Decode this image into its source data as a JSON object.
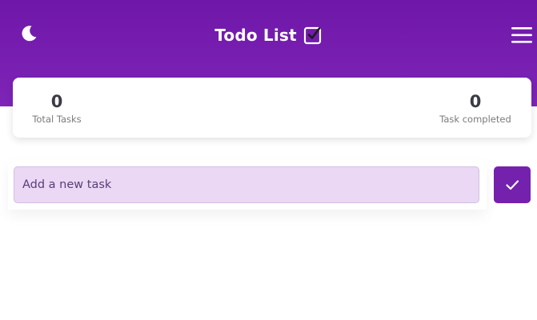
{
  "header": {
    "title": "Todo List",
    "theme_toggle_icon": "moon-icon",
    "title_icon": "checkbox-checked-icon",
    "menu_icon": "hamburger-menu-icon",
    "background_color": "#7a1fb3"
  },
  "stats": {
    "total_tasks": {
      "value": "0",
      "label": "Total Tasks"
    },
    "completed_tasks": {
      "value": "0",
      "label": "Task completed"
    }
  },
  "task_form": {
    "input_value": "",
    "input_placeholder": "Add a new task",
    "submit_icon": "check-icon",
    "accent_color": "#7421ae",
    "input_background": "#ead8f4"
  }
}
